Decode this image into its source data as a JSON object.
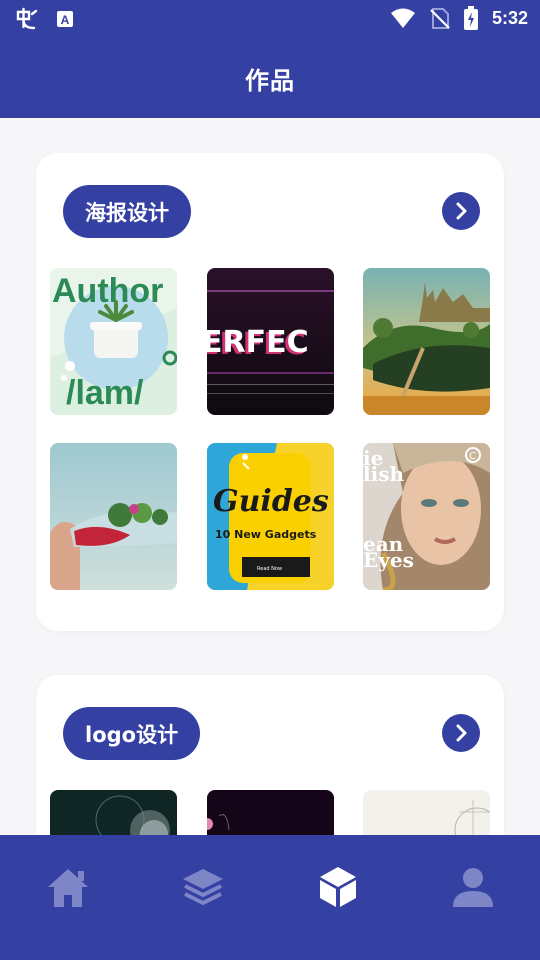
{
  "status_bar": {
    "time": "5:32"
  },
  "app_bar": {
    "title": "作品"
  },
  "sections": [
    {
      "title": "海报设计",
      "thumbnails": [
        {
          "text_lines": [
            "Author",
            "/lam/"
          ]
        },
        {
          "text_lines": [
            "ERFEC"
          ]
        },
        {
          "text_lines": []
        },
        {
          "text_lines": []
        },
        {
          "text_lines": [
            "Guides",
            "10 New Gadgets",
            "Read Now"
          ]
        },
        {
          "text_lines": [
            "ie",
            "lish",
            "ean",
            "Eyes"
          ]
        }
      ]
    },
    {
      "title": "logo设计",
      "thumbnails": [
        {},
        {},
        {}
      ]
    }
  ],
  "tab_bar": {
    "items": [
      {
        "icon": "home-icon",
        "active": false
      },
      {
        "icon": "layers-icon",
        "active": false
      },
      {
        "icon": "cube-icon",
        "active": true
      },
      {
        "icon": "person-icon",
        "active": false
      }
    ]
  },
  "colors": {
    "primary": "#3540a3",
    "background": "#f6f6f8",
    "inactive_icon": "#7f86c8"
  }
}
